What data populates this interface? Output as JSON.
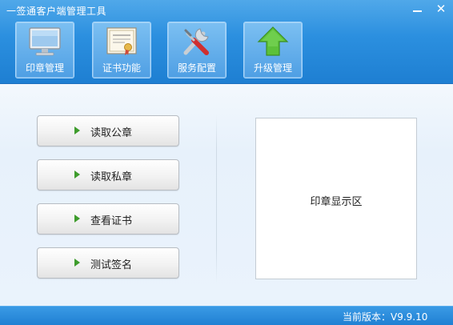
{
  "window": {
    "title": "一签通客户端管理工具",
    "minimize_icon": "minimize-icon",
    "close_icon": "close-icon",
    "close_glyph": "✕"
  },
  "toolbar": {
    "items": [
      {
        "label": "印章管理",
        "icon": "monitor-icon"
      },
      {
        "label": "证书功能",
        "icon": "certificate-icon"
      },
      {
        "label": "服务配置",
        "icon": "tools-icon"
      },
      {
        "label": "升级管理",
        "icon": "upgrade-arrow-icon"
      }
    ]
  },
  "actions": [
    {
      "label": "读取公章"
    },
    {
      "label": "读取私章"
    },
    {
      "label": "查看证书"
    },
    {
      "label": "测试签名"
    }
  ],
  "seal_display": {
    "label": "印章显示区"
  },
  "status_bar": {
    "version_text": "当前版本：V9.9.10"
  },
  "colors": {
    "header_blue": "#2b8fdf",
    "button_arrow_green": "#3e9c2c",
    "upgrade_green": "#5cc13a"
  }
}
